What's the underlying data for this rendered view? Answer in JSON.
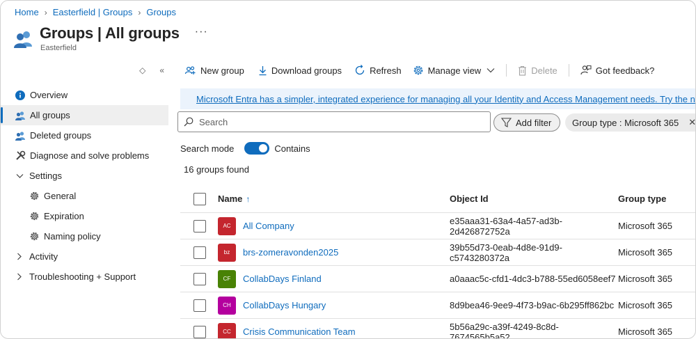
{
  "breadcrumb": [
    "Home",
    "Easterfield | Groups",
    "Groups"
  ],
  "header": {
    "title": "Groups | All groups",
    "subtitle": "Easterfield",
    "more": "···"
  },
  "sidebar": {
    "tools": {
      "sort": "◇",
      "collapse": "«"
    },
    "items": [
      {
        "label": "Overview",
        "icon": "info-icon"
      },
      {
        "label": "All groups",
        "icon": "groups-icon",
        "active": true
      },
      {
        "label": "Deleted groups",
        "icon": "groups-icon"
      },
      {
        "label": "Diagnose and solve problems",
        "icon": "wrench-icon"
      },
      {
        "label": "Settings",
        "expanded": true,
        "children": [
          {
            "label": "General",
            "icon": "gear-icon"
          },
          {
            "label": "Expiration",
            "icon": "gear-icon"
          },
          {
            "label": "Naming policy",
            "icon": "gear-icon"
          }
        ]
      },
      {
        "label": "Activity",
        "expanded": false
      },
      {
        "label": "Troubleshooting + Support",
        "expanded": false
      }
    ]
  },
  "toolbar": {
    "new_group": "New group",
    "download": "Download groups",
    "refresh": "Refresh",
    "manage_view": "Manage view",
    "delete": "Delete",
    "feedback": "Got feedback?"
  },
  "banner": {
    "text": "Microsoft Entra has a simpler, integrated experience for managing all your Identity and Access Management needs. Try the new Microsof"
  },
  "search": {
    "placeholder": "Search",
    "value": ""
  },
  "filters": {
    "add_filter": "Add filter",
    "active": "Group type : Microsoft 365",
    "remove": "✕"
  },
  "search_mode": {
    "label": "Search mode",
    "value": "Contains",
    "enabled": true
  },
  "result_count": "16 groups found",
  "table": {
    "columns": {
      "name": "Name",
      "sort": "↑",
      "object_id": "Object Id",
      "group_type": "Group type"
    },
    "rows": [
      {
        "initials": "AC",
        "color": "#c4262e",
        "name": "All Company",
        "object_id": "e35aaa31-63a4-4a57-ad3b-2d426872752a",
        "type": "Microsoft 365"
      },
      {
        "initials": "bz",
        "color": "#c4262e",
        "name": "brs-zomeravonden2025",
        "object_id": "39b55d73-0eab-4d8e-91d9-c5743280372a",
        "type": "Microsoft 365"
      },
      {
        "initials": "CF",
        "color": "#498205",
        "name": "CollabDays Finland",
        "object_id": "a0aaac5c-cfd1-4dc3-b788-55ed6058eef7",
        "type": "Microsoft 365"
      },
      {
        "initials": "CH",
        "color": "#b4009e",
        "name": "CollabDays Hungary",
        "object_id": "8d9bea46-9ee9-4f73-b9ac-6b295ff862bc",
        "type": "Microsoft 365"
      },
      {
        "initials": "CC",
        "color": "#c4262e",
        "name": "Crisis Communication Team",
        "object_id": "5b56a29c-a39f-4249-8c8d-7674565b5a52",
        "type": "Microsoft 365"
      }
    ]
  },
  "colors": {
    "accent": "#0f6cbd",
    "banner_bg": "#ebf3fc",
    "active_nav_bg": "#efefef"
  }
}
